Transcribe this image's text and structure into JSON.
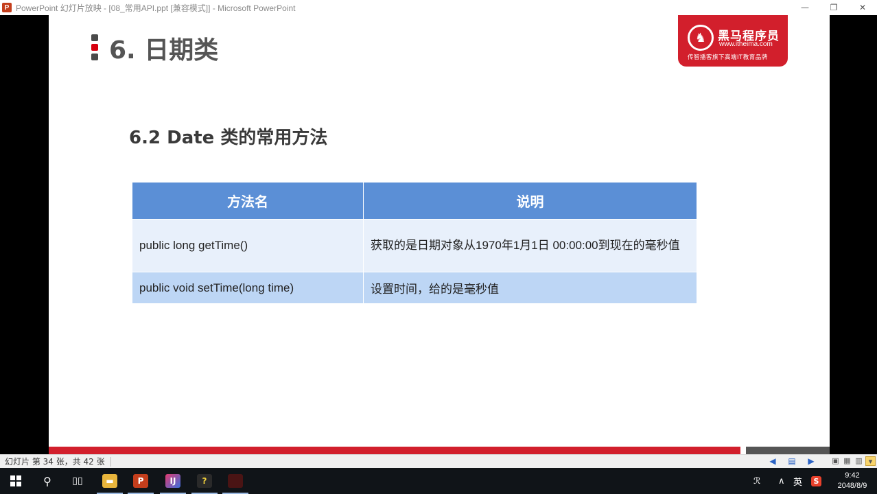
{
  "window": {
    "app_icon": "powerpoint-icon",
    "title": "PowerPoint 幻灯片放映 - [08_常用API.ppt [兼容模式]] - Microsoft PowerPoint",
    "controls": {
      "minimize": "—",
      "restore": "❐",
      "close": "✕"
    }
  },
  "slide": {
    "title": "6. 日期类",
    "logo": {
      "brand": "黑马程序员",
      "url": "www.itheima.com",
      "slogan": "传智播客旗下高端IT教育品牌"
    },
    "subtitle": "6.2 Date 类的常用方法",
    "table": {
      "headers": [
        "方法名",
        "说明"
      ],
      "rows": [
        {
          "method": "public long getTime()",
          "desc": "获取的是日期对象从1970年1月1日 00:00:00到现在的毫秒值"
        },
        {
          "method": "public void setTime(long time)",
          "desc": "设置时间，给的是毫秒值"
        }
      ]
    }
  },
  "statusbar": {
    "slide_count": "幻灯片 第 34 张，共 42 张"
  },
  "taskbar": {
    "apps": [
      "start-icon",
      "search-icon",
      "task-view-icon",
      "file-explorer-icon",
      "powerpoint-icon",
      "intellij-icon",
      "help-icon",
      "app-icon"
    ],
    "tray": {
      "ime": "英"
    },
    "clock": {
      "time": "9:42",
      "date": "2048/8/9"
    }
  },
  "colors": {
    "brand_red": "#d21f2c",
    "table_header": "#5b8fd6",
    "row_light": "#e8f0fb",
    "row_blue": "#bdd6f5"
  }
}
